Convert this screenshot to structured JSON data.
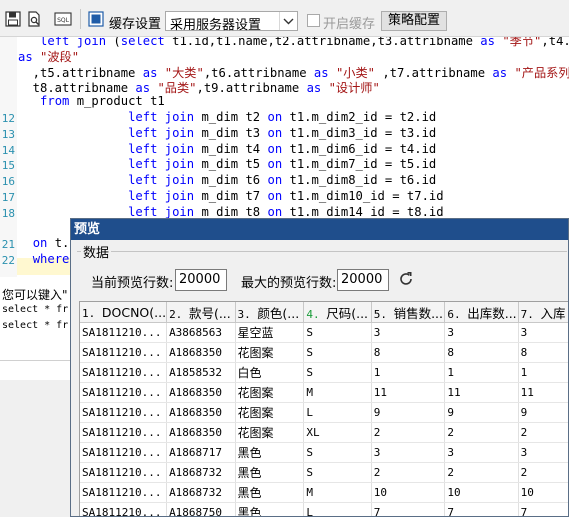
{
  "toolbar": {
    "cache_label": "缓存设置",
    "cache_option": "采用服务器设置",
    "enable_cache_label": "开启缓存",
    "enable_cache_checked": false,
    "policy_button": "策略配置",
    "icons": [
      "save-icon",
      "sql-format-icon",
      "cache-icon"
    ]
  },
  "editor": {
    "lines": [
      {
        "n": "",
        "text": "   left join (select t1.id,t1.name,t2.attribname,t3.attribname as \"季节\",t4.attribn"
      },
      {
        "n": "",
        "text": "as \"波段\""
      },
      {
        "n": "",
        "text": "  ,t5.attribname as \"大类\",t6.attribname as \"小类\" ,t7.attribname as \"产品系列\","
      },
      {
        "n": "",
        "text": "  t8.attribname as \"品类\",t9.attribname as \"设计师\""
      },
      {
        "n": "",
        "text": "   from m_product t1"
      },
      {
        "n": "12",
        "text": "               left join m_dim t2 on t1.m_dim2_id = t2.id"
      },
      {
        "n": "13",
        "text": "               left join m_dim t3 on t1.m_dim3_id = t3.id"
      },
      {
        "n": "14",
        "text": "               left join m_dim t4 on t1.m_dim6_id = t4.id"
      },
      {
        "n": "15",
        "text": "               left join m_dim t5 on t1.m_dim7_id = t5.id"
      },
      {
        "n": "16",
        "text": "               left join m_dim t6 on t1.m_dim8_id = t6.id"
      },
      {
        "n": "17",
        "text": "               left join m_dim t7 on t1.m_dim10_id = t7.id"
      },
      {
        "n": "18",
        "text": "               left join m_dim t8 on t1.m_dim14_id = t8.id"
      },
      {
        "n": "",
        "text": ""
      },
      {
        "n": "21",
        "text": "  on t."
      },
      {
        "n": "22",
        "text": "  where"
      }
    ]
  },
  "side_panel": {
    "hint": "您可以键入\"",
    "commands": [
      "select * fr",
      "select * fr"
    ]
  },
  "preview": {
    "title": "预览",
    "group_label": "数据",
    "current_rows_label": "当前预览行数:",
    "current_rows_value": "20000",
    "max_rows_label": "最大的预览行数:",
    "max_rows_value": "20000",
    "columns": [
      {
        "idx": "1.",
        "name": "DOCNO(..."
      },
      {
        "idx": "2.",
        "name": "款号(..."
      },
      {
        "idx": "3.",
        "name": "颜色(..."
      },
      {
        "idx": "4.",
        "name": "尺码(..."
      },
      {
        "idx": "5.",
        "name": "销售数..."
      },
      {
        "idx": "6.",
        "name": "出库数..."
      },
      {
        "idx": "7.",
        "name": "入库"
      }
    ],
    "rows": [
      [
        "SA1811210...",
        "A3868563",
        "星空蓝",
        "S",
        "3",
        "3",
        "3"
      ],
      [
        "SA1811210...",
        "A1868350",
        "花图案",
        "S",
        "8",
        "8",
        "8"
      ],
      [
        "SA1811210...",
        "A1858532",
        "白色",
        "S",
        "1",
        "1",
        "1"
      ],
      [
        "SA1811210...",
        "A1868350",
        "花图案",
        "M",
        "11",
        "11",
        "11"
      ],
      [
        "SA1811210...",
        "A1868350",
        "花图案",
        "L",
        "9",
        "9",
        "9"
      ],
      [
        "SA1811210...",
        "A1868350",
        "花图案",
        "XL",
        "2",
        "2",
        "2"
      ],
      [
        "SA1811210...",
        "A1868717",
        "黑色",
        "S",
        "3",
        "3",
        "3"
      ],
      [
        "SA1811210...",
        "A1868732",
        "黑色",
        "S",
        "2",
        "2",
        "2"
      ],
      [
        "SA1811210...",
        "A1868732",
        "黑色",
        "M",
        "10",
        "10",
        "10"
      ],
      [
        "SA1811210...",
        "A1868750",
        "黑色",
        "L",
        "7",
        "7",
        "7"
      ]
    ]
  },
  "colors": {
    "keyword": "#0000ff",
    "string": "#a31515",
    "line_number": "#2b91af",
    "dialog_title_bg": "#1f4e8c",
    "current_line_bg": "#fff8d0"
  }
}
